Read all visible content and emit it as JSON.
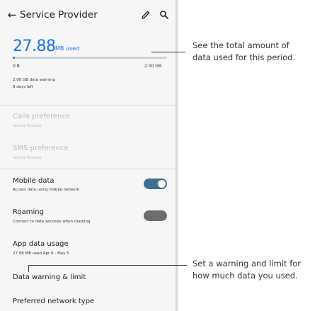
{
  "appbar": {
    "back_glyph": "←",
    "title": "Service Provider",
    "edit_icon": "pencil-icon",
    "search_icon": "search-icon"
  },
  "usage": {
    "amount": "27.88",
    "unit": "MB used",
    "progress_fraction": 0.014,
    "min_label": "0 B",
    "max_label": "2.00 GB",
    "warning_text": "2.00 GB data warning",
    "days_left": "9 days left"
  },
  "settings": {
    "calls_pref": {
      "title": "Calls preference",
      "subtitle": "Service Provider"
    },
    "sms_pref": {
      "title": "SMS preference",
      "subtitle": "Service Provider"
    },
    "mobile_data": {
      "title": "Mobile data",
      "subtitle": "Access data using mobile network",
      "on": true
    },
    "roaming": {
      "title": "Roaming",
      "subtitle": "Connect to data services when roaming",
      "on": false
    },
    "app_data_usage": {
      "title": "App data usage",
      "subtitle": "27.88 MB used Apr 6 - May 5"
    },
    "data_warning": {
      "title": "Data warning & limit"
    },
    "preferred_network": {
      "title": "Preferred network type"
    }
  },
  "callouts": {
    "total": "See the total amount of data used for this period.",
    "warning": "Set a warning and limit for how much data you used."
  },
  "colors": {
    "accent": "#1a73e8",
    "toggle_on": "#3e6e92",
    "toggle_off": "#6d6d6d",
    "panel_bg": "#f6f6f6"
  }
}
